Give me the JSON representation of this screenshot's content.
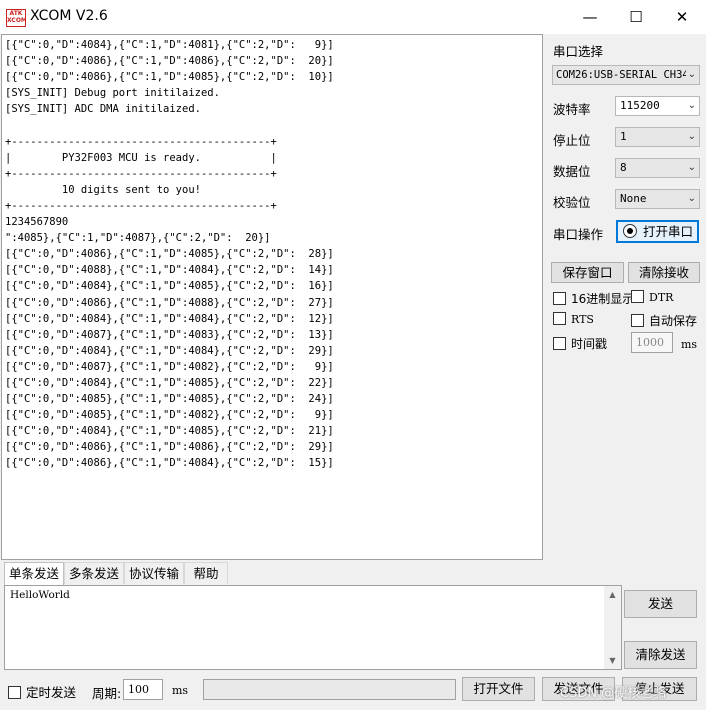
{
  "window": {
    "title": "XCOM V2.6",
    "logo_text": "ATK XCOM",
    "minimize": "—",
    "maximize": "☐",
    "close": "✕"
  },
  "receive": {
    "lines": [
      "[{\"C\":0,\"D\":4084},{\"C\":1,\"D\":4081},{\"C\":2,\"D\":   9}]",
      "[{\"C\":0,\"D\":4086},{\"C\":1,\"D\":4086},{\"C\":2,\"D\":  20}]",
      "[{\"C\":0,\"D\":4086},{\"C\":1,\"D\":4085},{\"C\":2,\"D\":  10}]",
      "[SYS_INIT] Debug port initilaized.",
      "[SYS_INIT] ADC DMA initilaized.",
      "",
      "+-----------------------------------------+",
      "|        PY32F003 MCU is ready.           |",
      "+-----------------------------------------+",
      "         10 digits sent to you!",
      "+-----------------------------------------+",
      "1234567890",
      "\":4085},{\"C\":1,\"D\":4087},{\"C\":2,\"D\":  20}]",
      "[{\"C\":0,\"D\":4086},{\"C\":1,\"D\":4085},{\"C\":2,\"D\":  28}]",
      "[{\"C\":0,\"D\":4088},{\"C\":1,\"D\":4084},{\"C\":2,\"D\":  14}]",
      "[{\"C\":0,\"D\":4084},{\"C\":1,\"D\":4085},{\"C\":2,\"D\":  16}]",
      "[{\"C\":0,\"D\":4086},{\"C\":1,\"D\":4088},{\"C\":2,\"D\":  27}]",
      "[{\"C\":0,\"D\":4084},{\"C\":1,\"D\":4084},{\"C\":2,\"D\":  12}]",
      "[{\"C\":0,\"D\":4087},{\"C\":1,\"D\":4083},{\"C\":2,\"D\":  13}]",
      "[{\"C\":0,\"D\":4084},{\"C\":1,\"D\":4084},{\"C\":2,\"D\":  29}]",
      "[{\"C\":0,\"D\":4087},{\"C\":1,\"D\":4082},{\"C\":2,\"D\":   9}]",
      "[{\"C\":0,\"D\":4084},{\"C\":1,\"D\":4085},{\"C\":2,\"D\":  22}]",
      "[{\"C\":0,\"D\":4085},{\"C\":1,\"D\":4085},{\"C\":2,\"D\":  24}]",
      "[{\"C\":0,\"D\":4085},{\"C\":1,\"D\":4082},{\"C\":2,\"D\":   9}]",
      "[{\"C\":0,\"D\":4084},{\"C\":1,\"D\":4085},{\"C\":2,\"D\":  21}]",
      "[{\"C\":0,\"D\":4086},{\"C\":1,\"D\":4086},{\"C\":2,\"D\":  29}]",
      "[{\"C\":0,\"D\":4086},{\"C\":1,\"D\":4084},{\"C\":2,\"D\":  15}]"
    ]
  },
  "port": {
    "port_label": "串口选择",
    "port_value": "COM26:USB-SERIAL CH34",
    "baud_label": "波特率",
    "baud_value": "115200",
    "stop_label": "停止位",
    "stop_value": "1",
    "data_label": "数据位",
    "data_value": "8",
    "parity_label": "校验位",
    "parity_value": "None",
    "op_label": "串口操作",
    "open_button": "打开串口"
  },
  "actions": {
    "save_window": "保存窗口",
    "clear_receive": "清除接收"
  },
  "options": {
    "hex_display": "16进制显示",
    "dtr": "DTR",
    "rts": "RTS",
    "auto_save": "自动保存",
    "timestamp": "时间戳",
    "timestamp_value": "1000",
    "timestamp_unit": "ms"
  },
  "tabs": [
    "单条发送",
    "多条发送",
    "协议传输",
    "帮助"
  ],
  "send": {
    "text": "HelloWorld",
    "send_button": "发送",
    "clear_send_button": "清除发送"
  },
  "bottom": {
    "timed_send": "定时发送",
    "period_label": "周期:",
    "period_value": "100",
    "period_unit": "ms",
    "open_file": "打开文件",
    "send_file": "发送文件",
    "stop_send": "停止发送"
  },
  "watermark": "CSDN @硬核老骆",
  "icons": {
    "dropdown": "chevron-down-icon",
    "scroll_up": "scroll-up-icon",
    "scroll_down": "scroll-down-icon"
  }
}
